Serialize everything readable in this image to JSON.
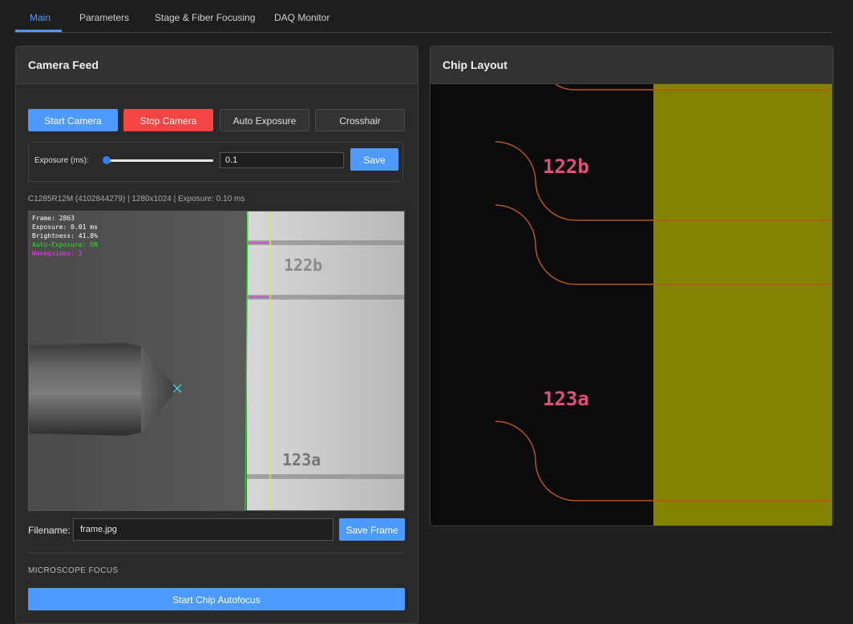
{
  "tabs": [
    {
      "label": "Main",
      "active": true
    },
    {
      "label": "Parameters"
    },
    {
      "label": "Stage & Fiber Focusing"
    },
    {
      "label": "DAQ Monitor"
    }
  ],
  "camera": {
    "title": "Camera Feed",
    "buttons": {
      "start": "Start Camera",
      "stop": "Stop Camera",
      "auto_exposure": "Auto Exposure",
      "crosshair": "Crosshair"
    },
    "exposure": {
      "label": "Exposure (ms):",
      "value": "0.1",
      "slider_fraction": 0.0,
      "save_label": "Save"
    },
    "info": "C1285R12M (4102844279) | 1280x1024 | Exposure: 0.10 ms",
    "overlay": {
      "frame": "Frame: 2863",
      "exposure": "Exposure: 0.01 ms",
      "brightness": "Brightness: 41.8%",
      "auto_exposure": "Auto-Exposure: ON",
      "waveguides": "Waveguides: 2"
    },
    "labels": {
      "top": "122b",
      "bottom": "123a"
    },
    "filename": {
      "label": "Filename:",
      "value": "frame.jpg",
      "save_label": "Save Frame"
    },
    "focus": {
      "section_title": "MICROSCOPE FOCUS",
      "autofocus_label": "Start Chip Autofocus"
    }
  },
  "chip": {
    "title": "Chip Layout",
    "labels": {
      "top": "122b",
      "bottom": "123a"
    }
  },
  "colors": {
    "accent": "#4e9bff",
    "danger": "#f44545",
    "waveguide": "#b8561a",
    "chip_label": "#e0507a",
    "chip_region": "#838300",
    "overlay_green": "#23e823",
    "overlay_magenta": "#ff33ff"
  }
}
